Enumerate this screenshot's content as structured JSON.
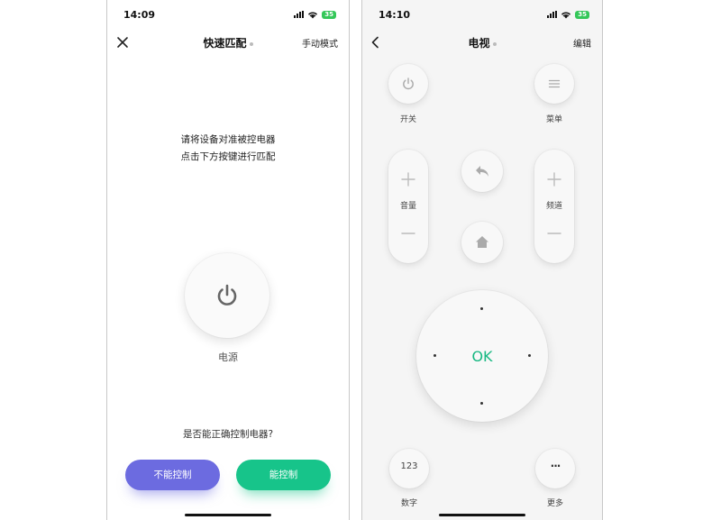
{
  "left_screen": {
    "status": {
      "time": "14:09",
      "battery": "35"
    },
    "nav": {
      "title": "快速匹配",
      "right_action": "手动模式"
    },
    "instruction": {
      "line1": "请将设备对准被控电器",
      "line2": "点击下方按键进行匹配"
    },
    "power": {
      "label": "电源"
    },
    "question": "是否能正确控制电器?",
    "buttons": {
      "cannot": "不能控制",
      "can": "能控制"
    },
    "colors": {
      "cannot": "#6c6be0",
      "can": "#17c48a"
    }
  },
  "right_screen": {
    "status": {
      "time": "14:10",
      "battery": "35"
    },
    "nav": {
      "title": "电视",
      "right_action": "编辑"
    },
    "power_label": "开关",
    "menu_label": "菜单",
    "volume_label": "音量",
    "channel_label": "频道",
    "ok_label": "OK",
    "numbers": {
      "glyph": "123",
      "label": "数字"
    },
    "more": {
      "glyph": "···",
      "label": "更多"
    },
    "colors": {
      "ok": "#17b882"
    }
  }
}
